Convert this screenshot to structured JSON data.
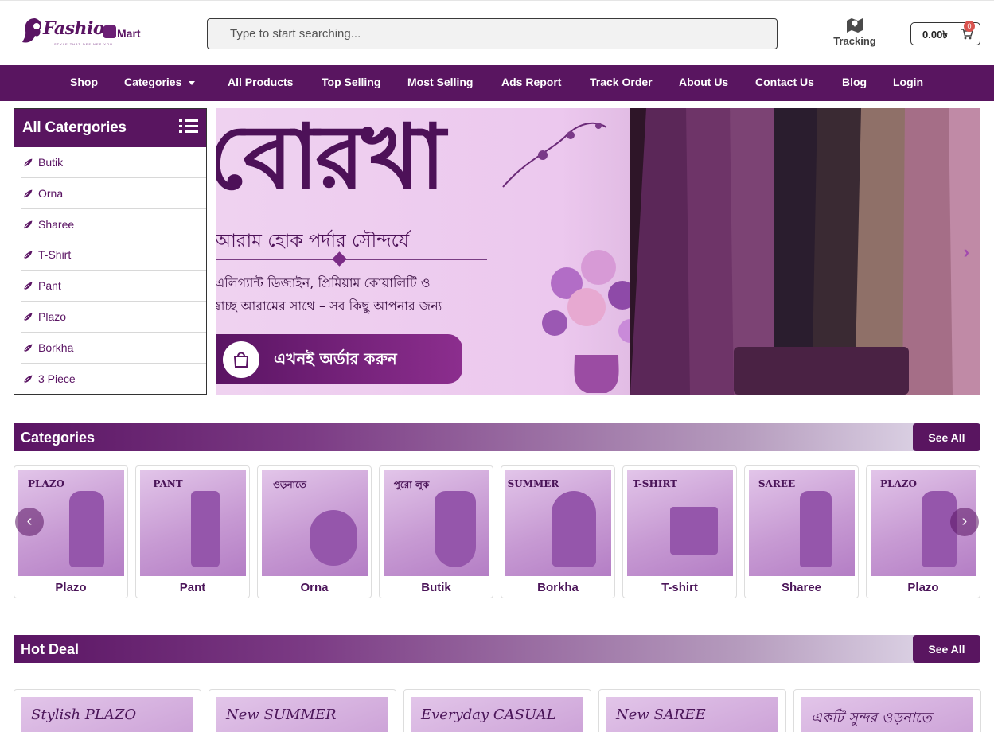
{
  "header": {
    "logo_text": "Fashion",
    "logo_suffix": "Mart",
    "logo_tagline": "STYLE THAT DEFINES YOU",
    "search_placeholder": "Type to start searching...",
    "tracking_label": "Tracking",
    "cart_amount": "0.00৳",
    "cart_count": "0"
  },
  "nav": {
    "items": [
      "Shop",
      "Categories",
      "All Products",
      "Top Selling",
      "Most Selling",
      "Ads Report",
      "Track Order",
      "About Us",
      "Contact Us",
      "Blog",
      "Login"
    ]
  },
  "sidebar": {
    "title": "All Catergories",
    "items": [
      "Butik",
      "Orna",
      "Sharee",
      "T-Shirt",
      "Pant",
      "Plazo",
      "Borkha",
      "3 Piece"
    ]
  },
  "hero": {
    "headline": "বোরখা",
    "line1": "আরাম হোক পর্দার সৌন্দর্যে",
    "line2": "এলিগ্যান্ট ডিজাইন, প্রিমিয়াম কোয়ালিটি ও",
    "line3": "স্বাচ্ছ আরামের সাথে – সব কিছু আপনার জন্য",
    "cta": "এখনই অর্ডার করুন"
  },
  "categories_section": {
    "title": "Categories",
    "see_all": "See All",
    "cards": [
      {
        "label": "Plazo",
        "img_text": "PLAZO"
      },
      {
        "label": "Pant",
        "img_text": "PANT"
      },
      {
        "label": "Orna",
        "img_text": "ওড়নাতে"
      },
      {
        "label": "Butik",
        "img_text": "পুরো লুক"
      },
      {
        "label": "Borkha",
        "img_text": "SUMMER"
      },
      {
        "label": "T-shirt",
        "img_text": "T-SHIRT"
      },
      {
        "label": "Sharee",
        "img_text": "SAREE"
      },
      {
        "label": "Plazo",
        "img_text": "PLAZO"
      }
    ]
  },
  "hot_deal_section": {
    "title": "Hot Deal",
    "see_all": "See All",
    "cards": [
      "Stylish PLAZO",
      "New SUMMER",
      "Everyday CASUAL",
      "New SAREE",
      "একটি সুন্দর ওড়নাতে"
    ]
  }
}
